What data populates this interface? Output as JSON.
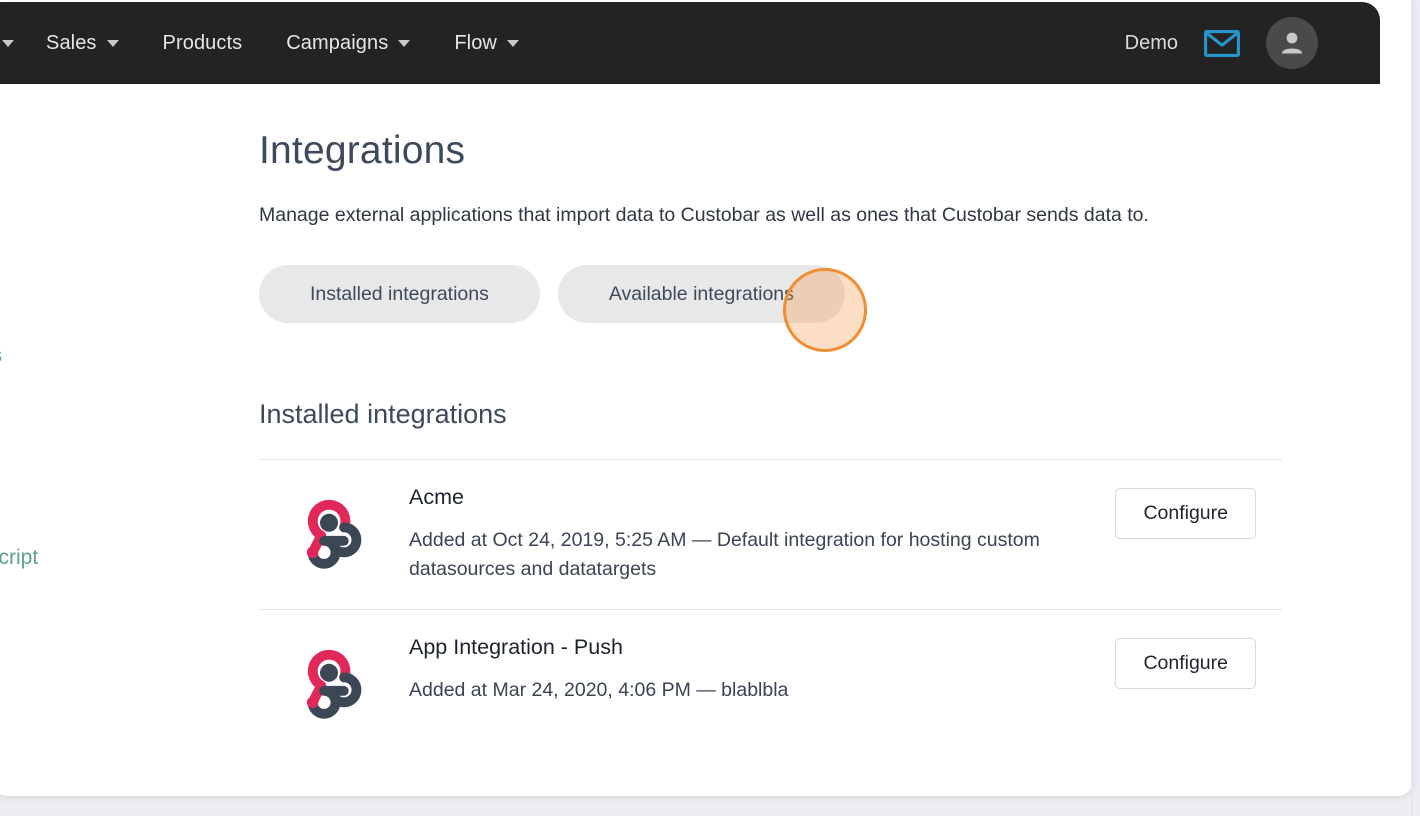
{
  "navbar": {
    "items": [
      {
        "label": "",
        "icon": "chevron-down-icon",
        "has_caret": true
      },
      {
        "label": "Sales",
        "icon": "chevron-down-icon",
        "has_caret": true
      },
      {
        "label": "Products",
        "icon": "",
        "has_caret": false
      },
      {
        "label": "Campaigns",
        "icon": "chevron-down-icon",
        "has_caret": true
      },
      {
        "label": "Flow",
        "icon": "chevron-down-icon",
        "has_caret": true
      }
    ],
    "account_label": "Demo",
    "mail_icon": "envelope-icon",
    "mail_icon_color": "#2596cc",
    "avatar_icon": "user-avatar-icon",
    "background_color": "#232323"
  },
  "sidebar_fragments": [
    {
      "label": "ns",
      "color": "#5aa486"
    },
    {
      "label": "script",
      "color": "#5aa486"
    }
  ],
  "page": {
    "title": "Integrations",
    "subtitle": "Manage external applications that import data to Custobar as well as ones that Custobar sends data to.",
    "title_color": "#3d4a5c"
  },
  "tabs": [
    {
      "label": "Installed integrations"
    },
    {
      "label": "Available integrations"
    }
  ],
  "section": {
    "heading": "Installed integrations"
  },
  "integrations": [
    {
      "name": "Acme",
      "description": "Added at Oct 24, 2019, 5:25 AM  —  Default integration for hosting custom datasources and datatargets",
      "logo": "webhooks-logo",
      "action_label": "Configure"
    },
    {
      "name": "App Integration - Push",
      "description": "Added at Mar 24, 2020, 4:06 PM  —  blablbla",
      "logo": "webhooks-logo",
      "action_label": "Configure"
    }
  ],
  "highlight": {
    "shape": "circle",
    "border_color": "#ef8f33",
    "fill_color": "rgba(243,146,55,0.30)",
    "target": "Available integrations"
  },
  "colors": {
    "accent_green": "#5aa486",
    "logo_pink": "#e1285a",
    "logo_dark": "#3b4754",
    "navbar_bg": "#232323",
    "page_bg": "#eceef1"
  }
}
